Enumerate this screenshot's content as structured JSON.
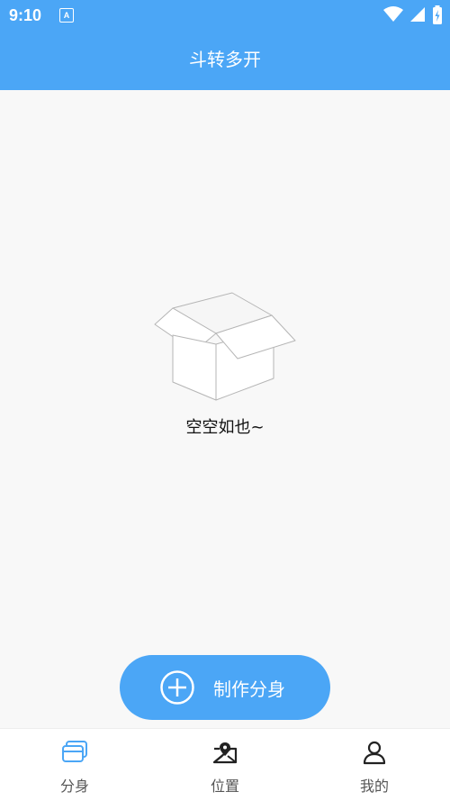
{
  "status_bar": {
    "time": "9:10",
    "notification_icon_letter": "A",
    "icons": [
      "wifi-icon",
      "signal-icon",
      "battery-icon"
    ]
  },
  "header": {
    "title": "斗转多开"
  },
  "empty_state": {
    "icon": "empty-box-icon",
    "message": "空空如也~"
  },
  "create_button": {
    "icon": "plus-circle-icon",
    "label": "制作分身"
  },
  "tabbar": {
    "tabs": [
      {
        "label": "分身",
        "icon": "clone-cards-icon",
        "active": true
      },
      {
        "label": "位置",
        "icon": "location-map-icon",
        "active": false
      },
      {
        "label": "我的",
        "icon": "user-icon",
        "active": false
      }
    ]
  },
  "colors": {
    "accent": "#4ba6f6",
    "background": "#f8f8f8",
    "tab_active": "#4ba6f6"
  }
}
